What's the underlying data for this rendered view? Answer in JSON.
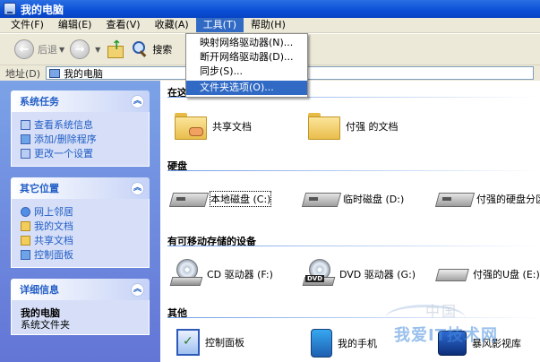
{
  "window": {
    "title": "我的电脑"
  },
  "menubar": {
    "items": [
      "文件(F)",
      "编辑(E)",
      "查看(V)",
      "收藏(A)",
      "工具(T)",
      "帮助(H)"
    ],
    "active_index": 4
  },
  "tools_menu": {
    "items": [
      "映射网络驱动器(N)...",
      "断开网络驱动器(D)...",
      "同步(S)...",
      "文件夹选项(O)..."
    ]
  },
  "toolbar": {
    "back_label": "后退",
    "search_label": "搜索"
  },
  "addressbar": {
    "label": "地址(D)",
    "value": "我的电脑"
  },
  "sidebar": {
    "system_tasks": {
      "title": "系统任务",
      "links": [
        "查看系统信息",
        "添加/删除程序",
        "更改一个设置"
      ]
    },
    "other_places": {
      "title": "其它位置",
      "links": [
        "网上邻居",
        "我的文档",
        "共享文档",
        "控制面板"
      ]
    },
    "details": {
      "title": "详细信息",
      "name": "我的电脑",
      "type": "系统文件夹"
    }
  },
  "content": {
    "sec_files": {
      "title": "在这",
      "items": [
        "共享文档",
        "付强 的文档"
      ]
    },
    "sec_hdd": {
      "title": "硬盘",
      "items": [
        "本地磁盘 (C:)",
        "临时磁盘 (D:)",
        "付强的硬盘分区"
      ]
    },
    "sec_removable": {
      "title": "有可移动存储的设备",
      "items": [
        "CD 驱动器 (F:)",
        "DVD 驱动器 (G:)",
        "付强的U盘 (E:)"
      ]
    },
    "sec_other": {
      "title": "其他",
      "items": [
        "控制面板",
        "我的手机",
        "暴风影视库"
      ]
    }
  },
  "watermark": {
    "brand": "我爱IT技术网",
    "top": "中国"
  }
}
